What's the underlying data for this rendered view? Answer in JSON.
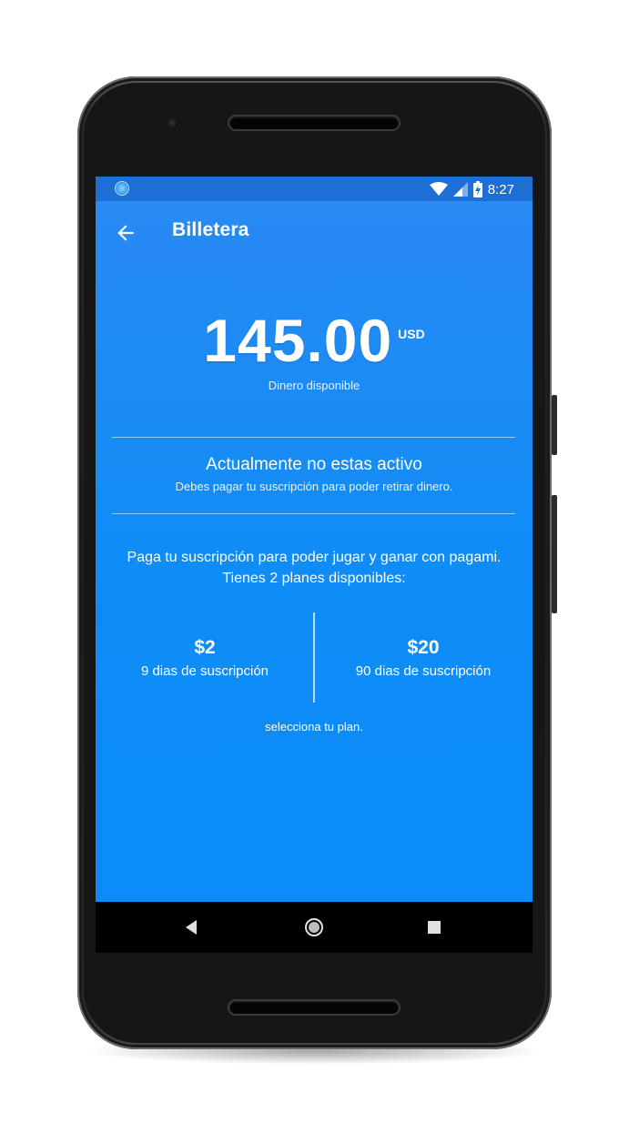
{
  "status_bar": {
    "time": "8:27",
    "icons": [
      "notification-icon",
      "wifi-icon",
      "signal-icon",
      "battery-icon"
    ]
  },
  "app_bar": {
    "title": "Billetera"
  },
  "balance": {
    "amount": "145.00",
    "currency": "USD",
    "label": "Dinero disponible"
  },
  "account_status": {
    "title": "Actualmente no estas activo",
    "subtitle": "Debes pagar tu suscripción para poder retirar dinero."
  },
  "promo": {
    "text": "Paga tu suscripción para poder jugar y ganar con pagami. Tienes 2 planes disponibles:"
  },
  "plans": [
    {
      "price": "$2",
      "description": "9 dias de suscripción"
    },
    {
      "price": "$20",
      "description": "90 dias de suscripción"
    }
  ],
  "select_hint": "selecciona tu plan.",
  "colors": {
    "screen_background": "#0f8cf6",
    "status_bar": "#1d6fd6",
    "text": "#ffffff",
    "nav_bar": "#000000"
  }
}
